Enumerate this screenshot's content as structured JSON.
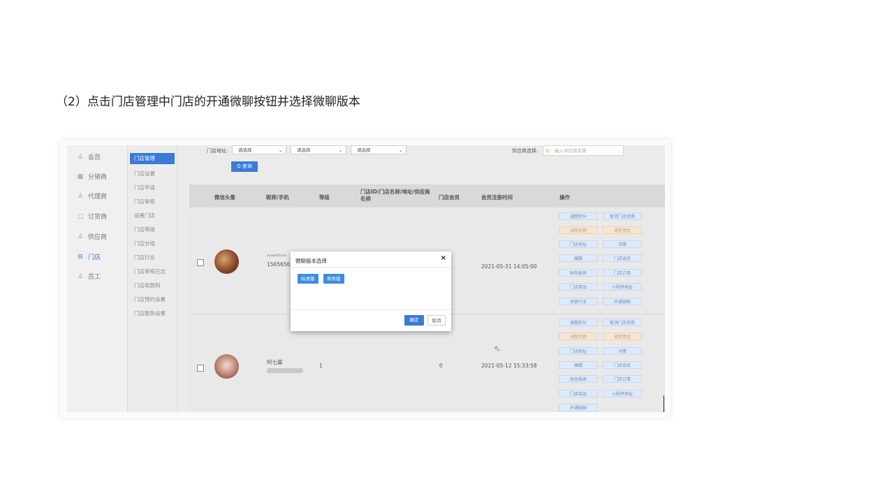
{
  "instruction": "（2）点击门店管理中门店的开通微聊按钮并选择微聊版本",
  "nav_main": [
    {
      "label": "会员",
      "icon": "user-icon"
    },
    {
      "label": "分销商",
      "icon": "grid-icon"
    },
    {
      "label": "代理商",
      "icon": "user-icon"
    },
    {
      "label": "订货商",
      "icon": "box-icon"
    },
    {
      "label": "供应商",
      "icon": "people-icon"
    },
    {
      "label": "门店",
      "icon": "store-icon",
      "active": true
    },
    {
      "label": "员工",
      "icon": "user-icon"
    }
  ],
  "nav_sub": [
    "门店管理",
    "门店设置",
    "门店申请",
    "门店审核",
    "设置门店",
    "门店等级",
    "门店分组",
    "门店行业",
    "门店审核日志",
    "门店收款码",
    "门店预约设置",
    "门店服务设置"
  ],
  "filters": {
    "address_label": "门店地址:",
    "select1": "请选择",
    "select2": "请选择",
    "select3": "请选择",
    "supplier_label": "供应商选择:",
    "supplier_placeholder": "输入供应商名称",
    "query_button": "Q 查询"
  },
  "table": {
    "headers": [
      "微信头像",
      "昵称/手机",
      "等级",
      "门店ID/门店名称/地址/供应商名称",
      "门店会员",
      "会员注册时间",
      "操作"
    ],
    "rows": [
      {
        "nickname": "ouaetbora",
        "phone": "15656565",
        "level": "",
        "members": "",
        "register_time": "2021-05-31 14:05:00"
      },
      {
        "nickname": "阿七酱",
        "phone": "",
        "level": "1",
        "members": "0",
        "register_time": "2021-05-12 15:33:58"
      }
    ],
    "ops_row1": [
      "调整积分",
      "取消门店资质",
      "调整余额",
      "调整佣金",
      "门店地址",
      "详情",
      "编辑",
      "门店会员",
      "财务报表",
      "门店订单",
      "门店商品",
      "小程序地址",
      "关联行业",
      "开通微聊"
    ],
    "ops_row2": [
      "调整积分",
      "取消门店资质",
      "调整余额",
      "调整佣金",
      "门店地址",
      "详情",
      "编辑",
      "门店会员",
      "财务报表",
      "门店订单",
      "门店商品",
      "小程序地址",
      "开通微聊"
    ]
  },
  "modal": {
    "title": "微聊版本选择",
    "close": "×",
    "option1": "标准版",
    "option2": "商务版",
    "confirm": "确定",
    "cancel": "取消"
  },
  "colors": {
    "primary": "#3a7bd5",
    "warn": "#f5e6d2"
  }
}
